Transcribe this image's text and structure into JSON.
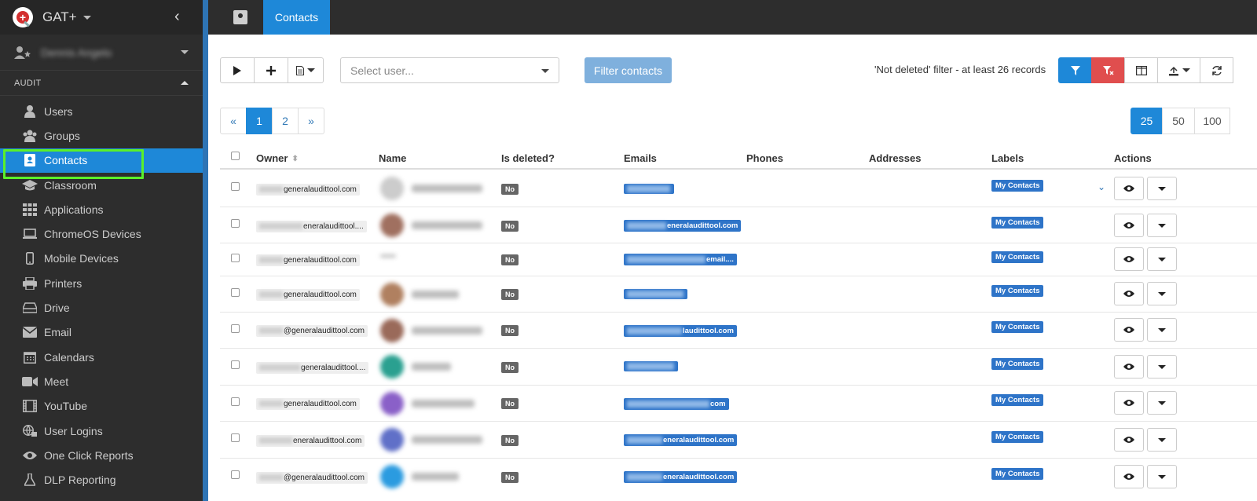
{
  "app": {
    "title": "GAT+",
    "user_name": "Dennis Angelo"
  },
  "sidebar": {
    "section": "AUDIT",
    "items": [
      {
        "label": "Users",
        "icon": "user-icon"
      },
      {
        "label": "Groups",
        "icon": "users-icon"
      },
      {
        "label": "Contacts",
        "icon": "contact-card-icon",
        "active": true
      },
      {
        "label": "Classroom",
        "icon": "graduation-cap-icon"
      },
      {
        "label": "Applications",
        "icon": "grid-icon"
      },
      {
        "label": "ChromeOS Devices",
        "icon": "laptop-icon"
      },
      {
        "label": "Mobile Devices",
        "icon": "mobile-icon"
      },
      {
        "label": "Printers",
        "icon": "printer-icon"
      },
      {
        "label": "Drive",
        "icon": "hard-drive-icon"
      },
      {
        "label": "Email",
        "icon": "envelope-icon"
      },
      {
        "label": "Calendars",
        "icon": "calendar-icon"
      },
      {
        "label": "Meet",
        "icon": "video-icon"
      },
      {
        "label": "YouTube",
        "icon": "film-icon"
      },
      {
        "label": "User Logins",
        "icon": "globe-lock-icon"
      },
      {
        "label": "One Click Reports",
        "icon": "eye-icon"
      },
      {
        "label": "DLP Reporting",
        "icon": "flask-icon"
      }
    ]
  },
  "topbar": {
    "tab_label": "Contacts"
  },
  "toolbar": {
    "select_placeholder": "Select user...",
    "filter_button": "Filter contacts",
    "filter_status": "'Not deleted' filter -  at least 26 records"
  },
  "pagination": {
    "prev": "«",
    "pages": [
      "1",
      "2"
    ],
    "next": "»",
    "current": "1"
  },
  "page_sizes": [
    "25",
    "50",
    "100"
  ],
  "table": {
    "headers": {
      "owner": "Owner",
      "name": "Name",
      "is_deleted": "Is deleted?",
      "emails": "Emails",
      "phones": "Phones",
      "addresses": "Addresses",
      "labels": "Labels",
      "actions": "Actions"
    },
    "rows": [
      {
        "owner": "generalaudittool.com",
        "deleted": "No",
        "email": "",
        "label": "My Contacts"
      },
      {
        "owner": "eneralaudittool....",
        "deleted": "No",
        "email": "eneralaudittool.com",
        "label": "My Contacts"
      },
      {
        "owner": "generalaudittool.com",
        "deleted": "No",
        "email": "email....",
        "label": "My Contacts"
      },
      {
        "owner": "generalaudittool.com",
        "deleted": "No",
        "email": "",
        "label": "My Contacts"
      },
      {
        "owner": "@generalaudittool.com",
        "deleted": "No",
        "email": "laudittool.com",
        "label": "My Contacts"
      },
      {
        "owner": "generalaudittool....",
        "deleted": "No",
        "email": "",
        "label": "My Contacts"
      },
      {
        "owner": "generalaudittool.com",
        "deleted": "No",
        "email": "com",
        "label": "My Contacts"
      },
      {
        "owner": "eneralaudittool.com",
        "deleted": "No",
        "email": "eneralaudittool.com",
        "label": "My Contacts"
      },
      {
        "owner": "@generalaudittool.com",
        "deleted": "No",
        "email": "eneralaudittool.com",
        "label": "My Contacts"
      }
    ]
  },
  "colors": {
    "accent": "#1e88d8",
    "sidebar": "#2d2d2d",
    "danger": "#e04e4e",
    "highlight": "#5af02a"
  }
}
